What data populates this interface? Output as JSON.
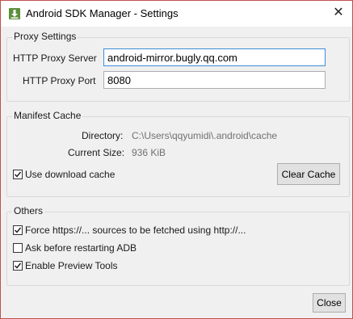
{
  "window": {
    "title": "Android SDK Manager - Settings",
    "close_glyph": "✕"
  },
  "proxy": {
    "group_title": "Proxy Settings",
    "server_label": "HTTP Proxy Server",
    "server_value": "android-mirror.bugly.qq.com",
    "port_label": "HTTP Proxy Port",
    "port_value": "8080"
  },
  "manifest": {
    "group_title": "Manifest Cache",
    "directory_label": "Directory:",
    "directory_value": "C:\\Users\\qqyumidi\\.android\\cache",
    "size_label": "Current Size:",
    "size_value": "936 KiB",
    "use_cache_label": "Use download cache",
    "use_cache_checked": true,
    "clear_cache_label": "Clear Cache"
  },
  "others": {
    "group_title": "Others",
    "options": [
      {
        "label": "Force https://... sources to be fetched using http://...",
        "checked": true
      },
      {
        "label": "Ask before restarting ADB",
        "checked": false
      },
      {
        "label": "Enable Preview Tools",
        "checked": true
      }
    ]
  },
  "footer": {
    "close_label": "Close"
  }
}
